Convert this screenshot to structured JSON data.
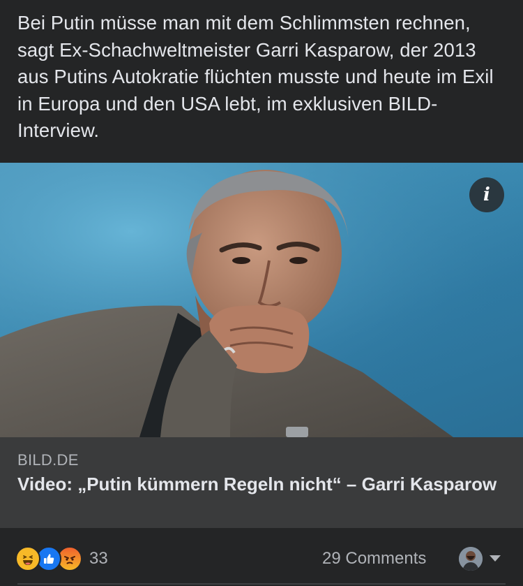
{
  "post": {
    "text": "Bei Putin müsse man mit dem Schlimmsten rechnen, sagt Ex-Schachweltmeister Garri Kasparow, der 2013 aus Putins Autokratie flüchten musste und heute im Exil in Europa und den USA lebt, im exklusiven BILD-Interview."
  },
  "media": {
    "info_icon": "i"
  },
  "link": {
    "domain": "BILD.DE",
    "title": "Video: „Putin kümmern Regeln nicht“ – Garri Kasparow"
  },
  "footer": {
    "reactions": [
      "haha",
      "like",
      "angry"
    ],
    "reaction_count": "33",
    "comments_label": "29 Comments"
  },
  "colors": {
    "background": "#242526",
    "card": "#3a3b3c",
    "text": "#e4e6eb",
    "muted": "#b0b3b8",
    "like": "#1877f2",
    "haha": "#f7b928",
    "angry": "#f0612d"
  }
}
